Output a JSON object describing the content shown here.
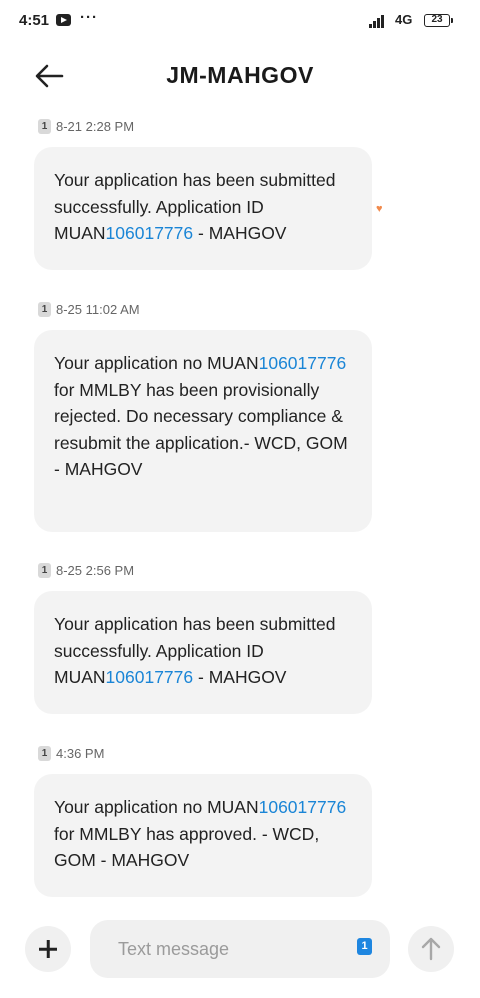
{
  "status_bar": {
    "time": "4:51",
    "more": "···",
    "network": "4G",
    "battery": "23"
  },
  "header": {
    "title": "JM-MAHGOV"
  },
  "messages": [
    {
      "sim": "1",
      "timestamp": "8-21 2:28 PM",
      "text_before": "Your application has been submitted successfully. Application ID MUAN",
      "link": "106017776",
      "text_after": "  - MAHGOV",
      "reaction": "heart-icon"
    },
    {
      "sim": "1",
      "timestamp": "8-25 11:02 AM",
      "text_before": "Your application no MUAN",
      "link": "106017776",
      "text_after": " for MMLBY has been provisionally rejected. Do necessary compliance & resubmit the application.- WCD, GOM - MAHGOV"
    },
    {
      "sim": "1",
      "timestamp": "8-25 2:56 PM",
      "text_before": "Your application has been submitted successfully. Application ID MUAN",
      "link": "106017776",
      "text_after": "  - MAHGOV"
    },
    {
      "sim": "1",
      "timestamp": "4:36 PM",
      "text_before": "Your application no MUAN",
      "link": "106017776",
      "text_after": " for MMLBY has approved. - WCD, GOM - MAHGOV"
    }
  ],
  "composer": {
    "placeholder": "Text message",
    "sim": "1"
  },
  "colors": {
    "link": "#1a85d6",
    "bubble": "#f3f3f3",
    "sim_select": "#1e86e0",
    "heart": "#f18a4c"
  }
}
